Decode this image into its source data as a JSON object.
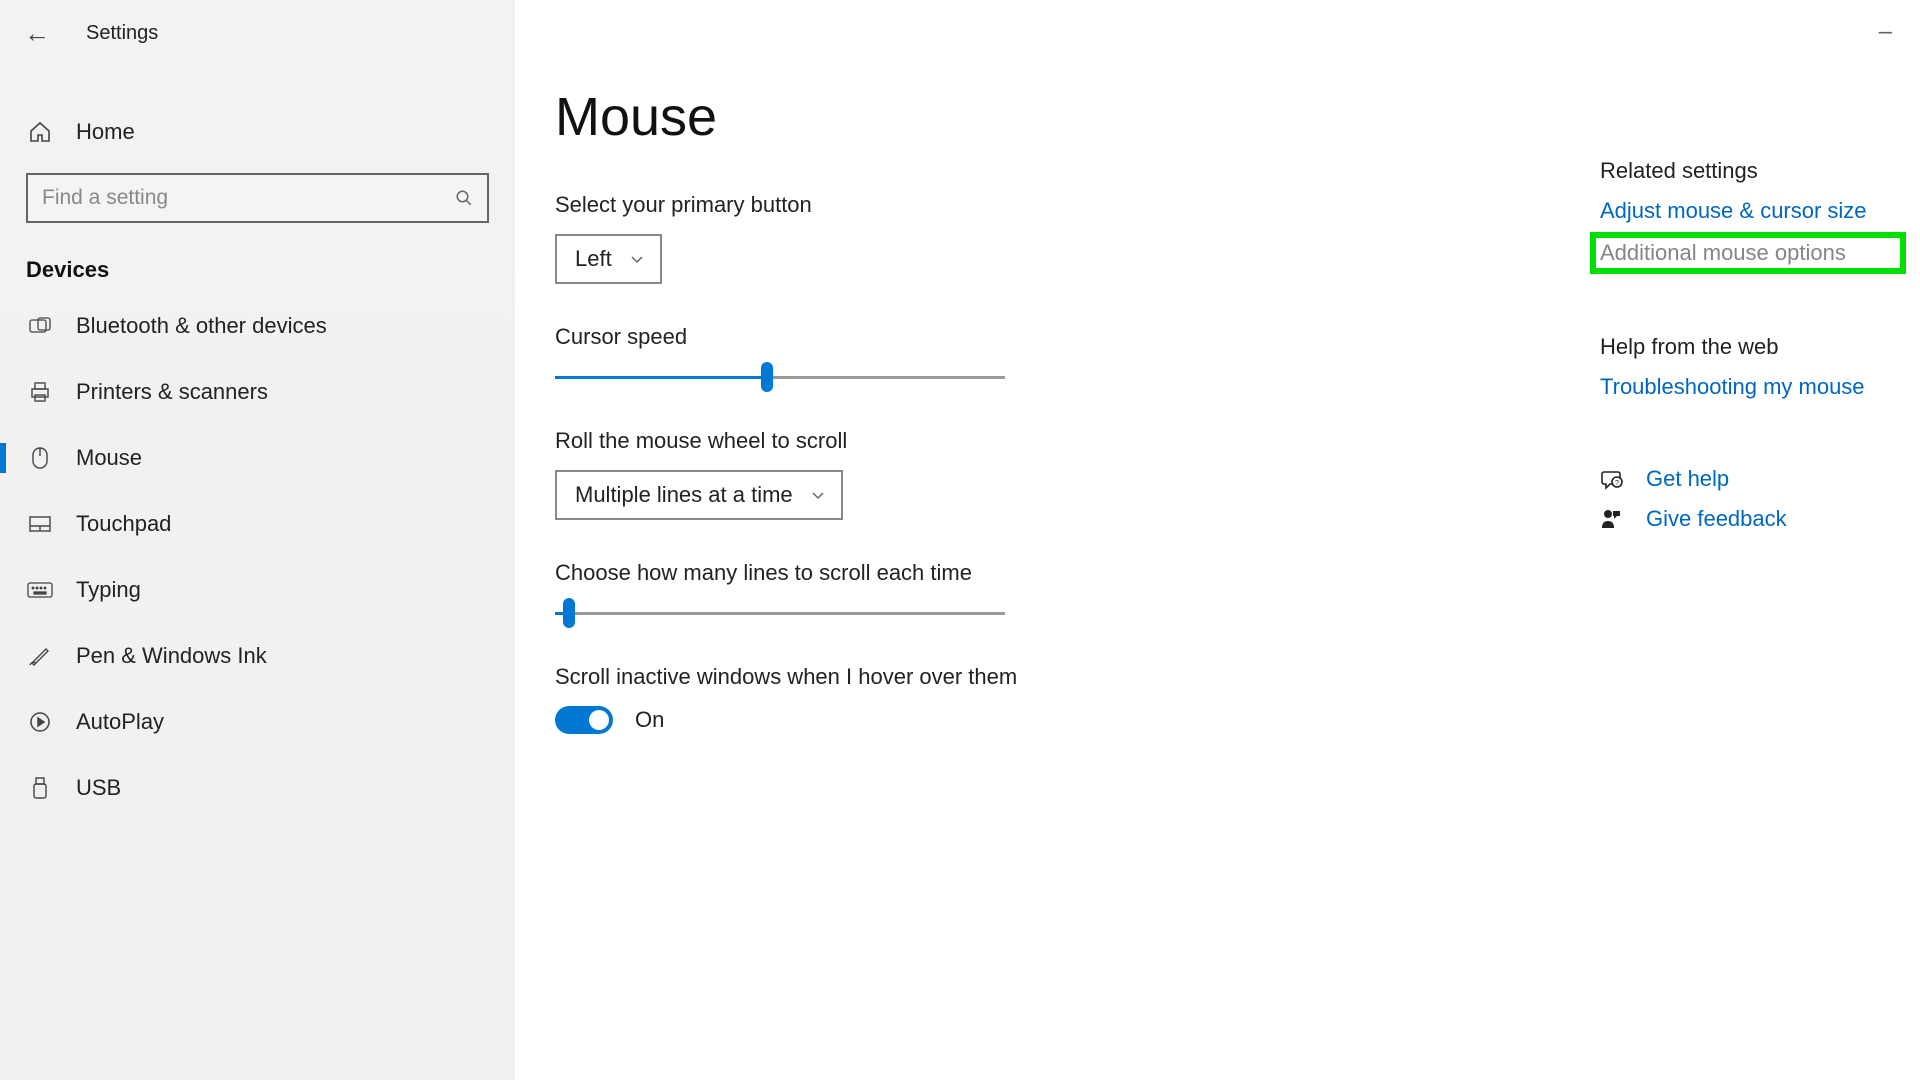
{
  "app_title": "Settings",
  "sidebar": {
    "home_label": "Home",
    "search_placeholder": "Find a setting",
    "category_label": "Devices",
    "items": [
      {
        "label": "Bluetooth & other devices",
        "active": false
      },
      {
        "label": "Printers & scanners",
        "active": false
      },
      {
        "label": "Mouse",
        "active": true
      },
      {
        "label": "Touchpad",
        "active": false
      },
      {
        "label": "Typing",
        "active": false
      },
      {
        "label": "Pen & Windows Ink",
        "active": false
      },
      {
        "label": "AutoPlay",
        "active": false
      },
      {
        "label": "USB",
        "active": false
      }
    ]
  },
  "main": {
    "page_title": "Mouse",
    "primary_button_label": "Select your primary button",
    "primary_button_value": "Left",
    "cursor_speed_label": "Cursor speed",
    "cursor_speed_percent": 47,
    "scroll_wheel_label": "Roll the mouse wheel to scroll",
    "scroll_wheel_value": "Multiple lines at a time",
    "scroll_lines_label": "Choose how many lines to scroll each time",
    "scroll_lines_percent": 3,
    "inactive_label": "Scroll inactive windows when I hover over them",
    "inactive_state": "On"
  },
  "right": {
    "related_heading": "Related settings",
    "link_adjust": "Adjust mouse & cursor size",
    "link_additional": "Additional mouse options",
    "help_heading": "Help from the web",
    "link_troubleshoot": "Troubleshooting my mouse",
    "get_help": "Get help",
    "give_feedback": "Give feedback"
  }
}
